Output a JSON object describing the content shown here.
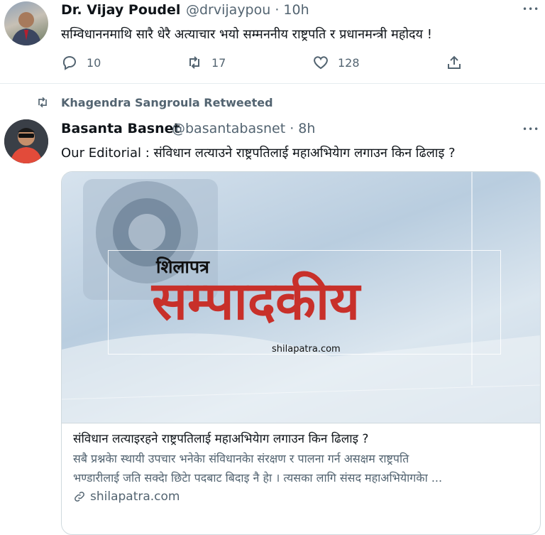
{
  "tweet1": {
    "author_name": "Dr. Vijay Poudel",
    "handle_time": "@drvijaypou · 10h",
    "text": "सम्विधाननमाथि सारै धेरै अत्याचार भयो सम्मननीय राष्ट्रपति र प्रधानमन्त्री महोदय !",
    "more": "•••",
    "actions": {
      "reply_count": "10",
      "retweet_count": "17",
      "like_count": "128"
    }
  },
  "retweet_banner": {
    "label": "Khagendra Sangroula Retweeted"
  },
  "tweet2": {
    "author_name": "Basanta Basnet",
    "handle_time": "@basantabasnet · 8h",
    "text": "Our Editorial : संविधान लत्याउने राष्ट्रपतिलाई महाअभियेाग लगाउन किन ढिलाइ ?",
    "more": "•••",
    "card": {
      "image_kicker": "शिलापत्र",
      "image_headline": "सम्पादकीय",
      "image_domain": "shilapatra.com",
      "title": "संविधान लत्याइरहने राष्ट्रपतिलाई महाअभियेाग लगाउन किन ढिलाइ ?",
      "desc_line1": "सबै प्रश्नकेा स्थायी उपचार भनेकेा संविधानकेा संरक्षण र पालना गर्न असक्षम राष्ट्रपति",
      "desc_line2": "भण्डारीलाई जति सक्देा छिटेा पदबाट बिदाइ नै हेा । त्यसका लागि संसद महाअभियेागकेा ...",
      "domain": "shilapatra.com"
    }
  },
  "colors": {
    "accent": "#1d9bf0",
    "secondary": "#536471",
    "headline_red": "#c8302a"
  }
}
